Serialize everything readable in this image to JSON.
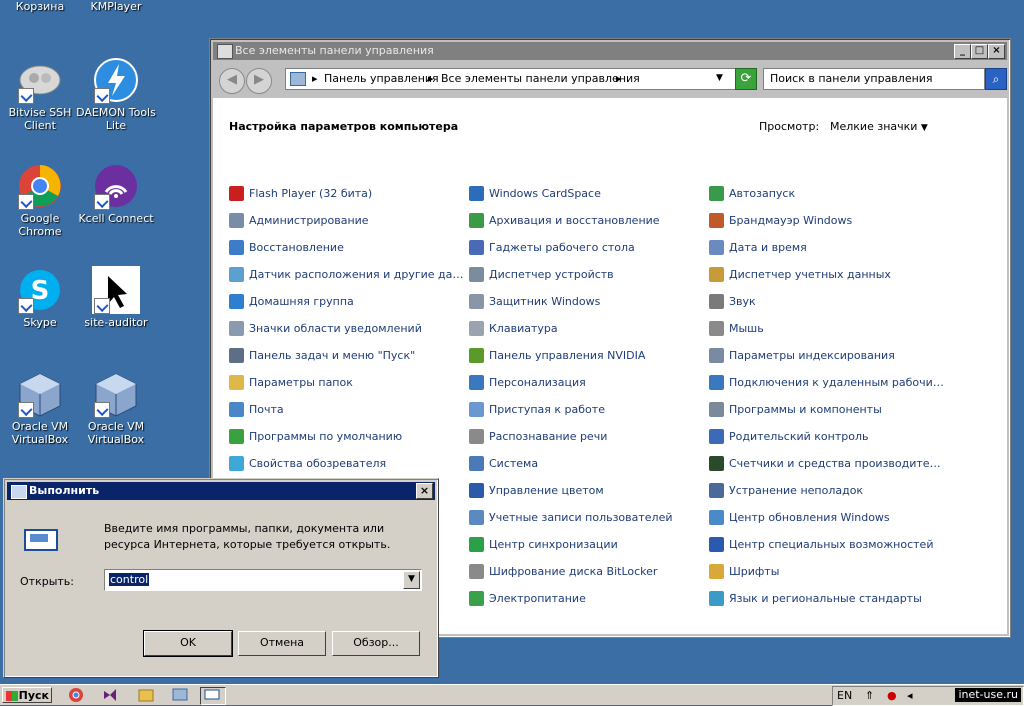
{
  "desktop": {
    "icons": [
      {
        "label": "Корзина"
      },
      {
        "label": "KMPlayer"
      },
      {
        "label": "Bitvise SSH Client"
      },
      {
        "label": "DAEMON Tools Lite"
      },
      {
        "label": "Google Chrome"
      },
      {
        "label": "Kcell Connect"
      },
      {
        "label": "Skype"
      },
      {
        "label": "site-auditor"
      },
      {
        "label": "Oracle VM VirtualBox"
      },
      {
        "label": "Oracle VM VirtualBox"
      }
    ]
  },
  "control_panel": {
    "title": "Все элементы панели управления",
    "breadcrumb": [
      "Панель управления",
      "Все элементы панели управления"
    ],
    "search_placeholder": "Поиск в панели управления",
    "heading": "Настройка параметров компьютера",
    "view_label": "Просмотр:",
    "view_value": "Мелкие значки",
    "columns": [
      [
        {
          "label": "Flash Player (32 бита)",
          "color": "#c8201e"
        },
        {
          "label": "Администрирование",
          "color": "#7a8da8"
        },
        {
          "label": "Восстановление",
          "color": "#3d7cc9"
        },
        {
          "label": "Датчик расположения и другие датч...",
          "color": "#5aa0d0"
        },
        {
          "label": "Домашняя группа",
          "color": "#2f7fd0"
        },
        {
          "label": "Значки области уведомлений",
          "color": "#8a9bb0"
        },
        {
          "label": "Панель задач и меню \"Пуск\"",
          "color": "#5e6e84"
        },
        {
          "label": "Параметры папок",
          "color": "#e0b84a"
        },
        {
          "label": "Почта",
          "color": "#4a86c8"
        },
        {
          "label": "Программы по умолчанию",
          "color": "#3aa040"
        },
        {
          "label": "Свойства обозревателя",
          "color": "#3fa8d8"
        }
      ],
      [
        {
          "label": "Windows CardSpace",
          "color": "#2d6cb8"
        },
        {
          "label": "Архивация и восстановление",
          "color": "#3a9a48"
        },
        {
          "label": "Гаджеты рабочего стола",
          "color": "#4a6ab8"
        },
        {
          "label": "Диспетчер устройств",
          "color": "#7a8c9e"
        },
        {
          "label": "Защитник Windows",
          "color": "#8a96a8"
        },
        {
          "label": "Клавиатура",
          "color": "#9aa4b0"
        },
        {
          "label": "Панель управления NVIDIA",
          "color": "#5a9a2a"
        },
        {
          "label": "Персонализация",
          "color": "#3a78c0"
        },
        {
          "label": "Приступая к работе",
          "color": "#6a98d0"
        },
        {
          "label": "Распознавание речи",
          "color": "#8a8a8a"
        },
        {
          "label": "Система",
          "color": "#4a7ab8"
        },
        {
          "label": "Управление цветом",
          "color": "#2a5aa8"
        },
        {
          "label": "Учетные записи пользователей",
          "color": "#5a8ac0"
        },
        {
          "label": "Центр синхронизации",
          "color": "#2aa048"
        },
        {
          "label": "Шифрование диска BitLocker",
          "color": "#8a8a8a"
        },
        {
          "label": "Электропитание",
          "color": "#3aa04a"
        }
      ],
      [
        {
          "label": "Автозапуск",
          "color": "#3a9a4a"
        },
        {
          "label": "Брандмауэр Windows",
          "color": "#c05a2a"
        },
        {
          "label": "Дата и время",
          "color": "#6a8ac0"
        },
        {
          "label": "Диспетчер учетных данных",
          "color": "#c89a3a"
        },
        {
          "label": "Звук",
          "color": "#7a7a7a"
        },
        {
          "label": "Мышь",
          "color": "#8a8a8a"
        },
        {
          "label": "Параметры индексирования",
          "color": "#7a8aa0"
        },
        {
          "label": "Подключения к удаленным рабочим с...",
          "color": "#3a78c0"
        },
        {
          "label": "Программы и компоненты",
          "color": "#7a8a9a"
        },
        {
          "label": "Родительский контроль",
          "color": "#3a6ab8"
        },
        {
          "label": "Счетчики и средства производитель...",
          "color": "#2a4a2a"
        },
        {
          "label": "Устранение неполадок",
          "color": "#4a6a9a"
        },
        {
          "label": "Центр обновления Windows",
          "color": "#4a8ac8"
        },
        {
          "label": "Центр специальных возможностей",
          "color": "#2a5ab0"
        },
        {
          "label": "Шрифты",
          "color": "#d8a83a"
        },
        {
          "label": "Язык и региональные стандарты",
          "color": "#3a9ac8"
        }
      ]
    ]
  },
  "run_dialog": {
    "title": "Выполнить",
    "prompt": "Введите имя программы, папки, документа или ресурса Интернета, которые требуется открыть.",
    "open_label": "Открыть:",
    "input_value": "control",
    "ok_label": "OK",
    "cancel_label": "Отмена",
    "browse_label": "Обзор..."
  },
  "taskbar": {
    "start_label": "Пуск",
    "lang": "EN",
    "clock": "inet-use.ru"
  }
}
